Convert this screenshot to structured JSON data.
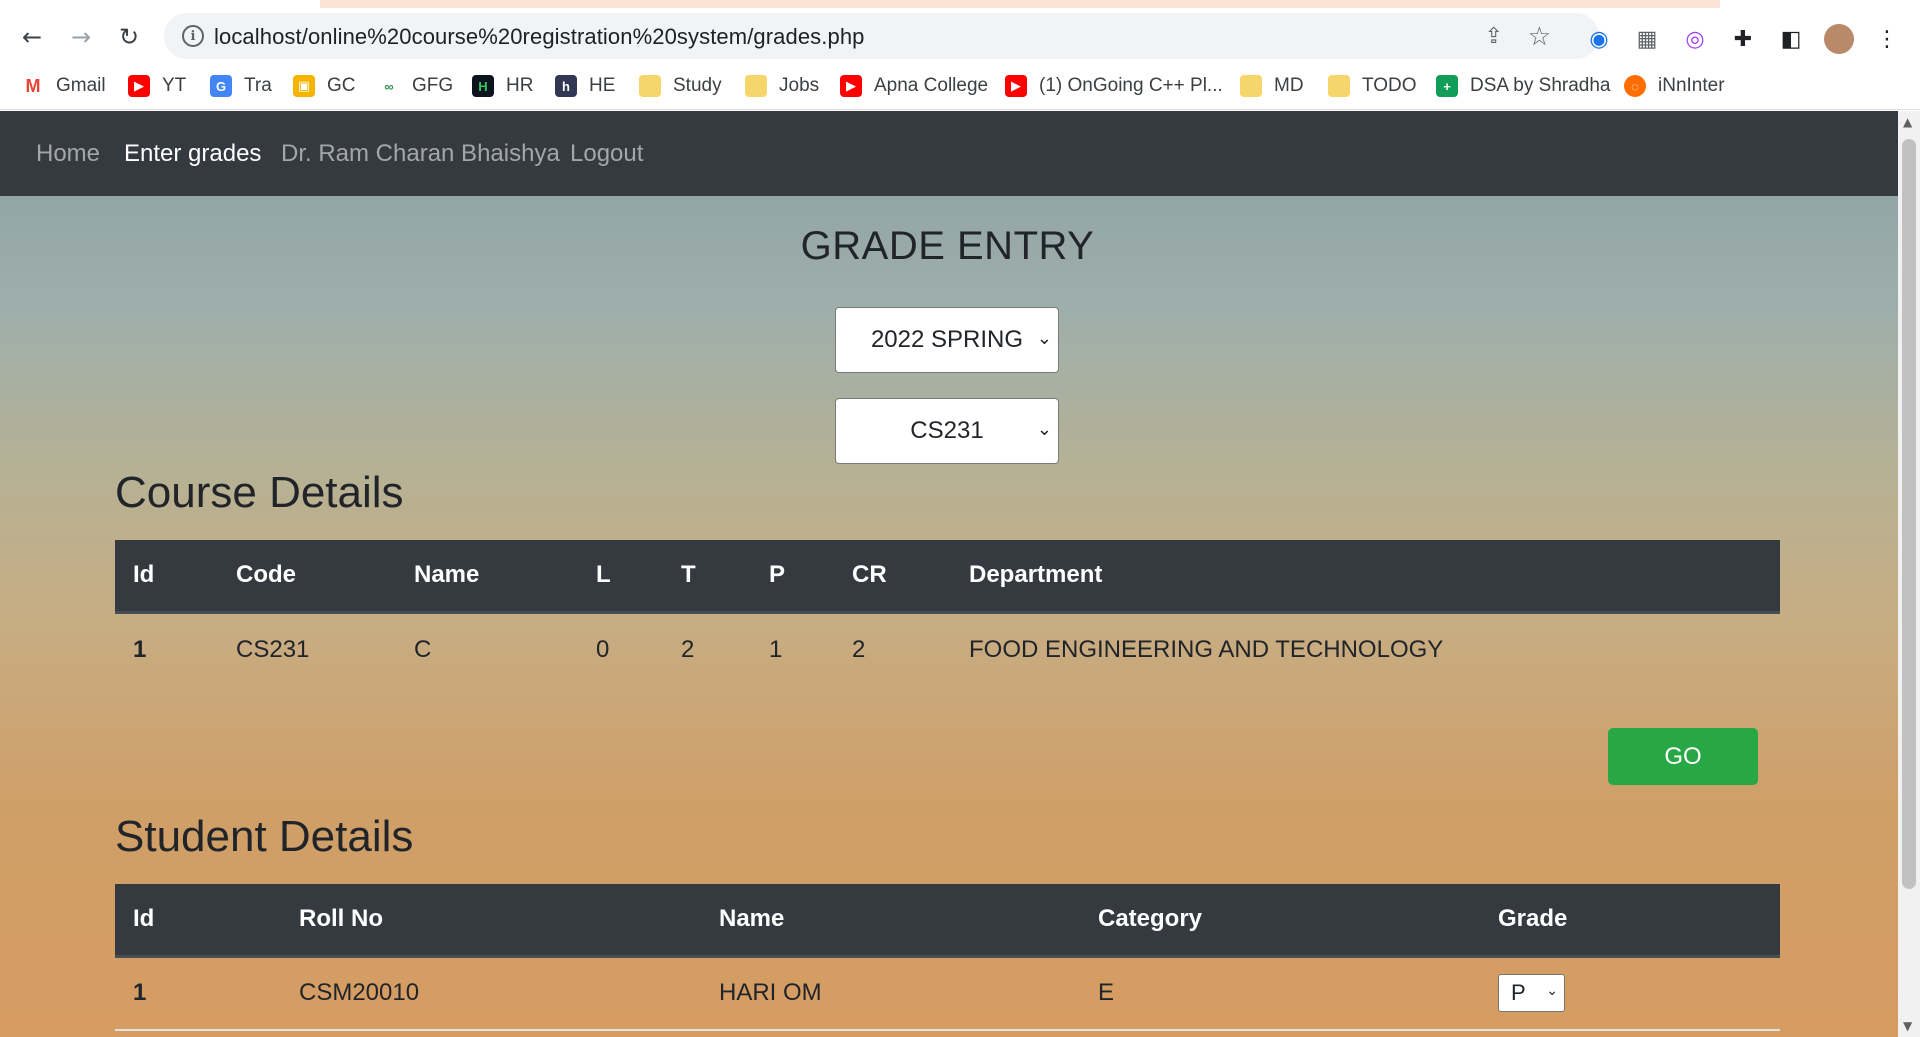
{
  "browser": {
    "url": "localhost/online%20course%20registration%20system/grades.php",
    "bookmarks": [
      {
        "label": "Gmail",
        "icon": "gmail-icon"
      },
      {
        "label": "YT",
        "icon": "youtube-icon"
      },
      {
        "label": "Tra",
        "icon": "translate-icon"
      },
      {
        "label": "GC",
        "icon": "classroom-icon"
      },
      {
        "label": "GFG",
        "icon": "gfg-icon"
      },
      {
        "label": "HR",
        "icon": "hackerrank-icon"
      },
      {
        "label": "HE",
        "icon": "hackerearth-icon"
      },
      {
        "label": "Study",
        "icon": "folder-icon"
      },
      {
        "label": "Jobs",
        "icon": "folder-icon"
      },
      {
        "label": "Apna College",
        "icon": "youtube-icon"
      },
      {
        "label": "(1) OnGoing C++ Pl...",
        "icon": "youtube-icon"
      },
      {
        "label": "MD",
        "icon": "folder-icon"
      },
      {
        "label": "TODO",
        "icon": "folder-icon"
      },
      {
        "label": "DSA by Shradha",
        "icon": "sheets-icon"
      },
      {
        "label": "iNnInter",
        "icon": "globe-icon"
      }
    ]
  },
  "navbar": {
    "home": "Home",
    "enter_grades": "Enter grades",
    "user": "Dr. Ram Charan Bhaishya",
    "logout": "Logout"
  },
  "page": {
    "title": "GRADE ENTRY",
    "semester_select": "2022 SPRING",
    "course_select": "CS231",
    "go_label": "GO"
  },
  "course_details": {
    "heading": "Course Details",
    "headers": [
      "Id",
      "Code",
      "Name",
      "L",
      "T",
      "P",
      "CR",
      "Department"
    ],
    "rows": [
      [
        "1",
        "CS231",
        "C",
        "0",
        "2",
        "1",
        "2",
        "FOOD ENGINEERING AND TECHNOLOGY"
      ]
    ]
  },
  "student_details": {
    "heading": "Student Details",
    "headers": [
      "Id",
      "Roll No",
      "Name",
      "Category",
      "Grade"
    ],
    "rows": [
      {
        "id": "1",
        "roll": "CSM20010",
        "name": "HARI OM",
        "category": "E",
        "grade": "P"
      }
    ]
  },
  "colors": {
    "navbar": "#343a40",
    "go_button": "#28a745"
  }
}
